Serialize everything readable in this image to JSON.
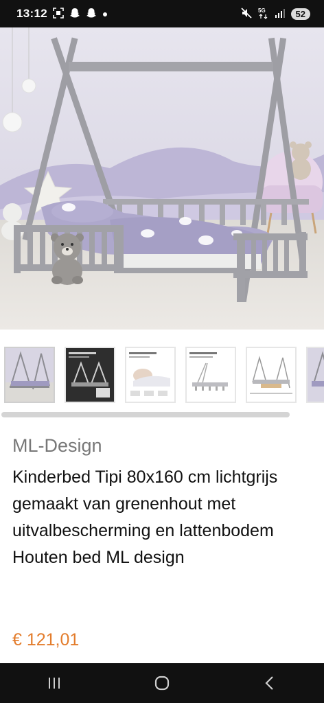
{
  "status_bar": {
    "time": "13:12",
    "battery": "52",
    "left_icons": [
      "screenshot-icon",
      "snapchat-ghost-icon",
      "snapchat-ghost-icon",
      "dot-icon"
    ],
    "right_icons": [
      "mute-icon",
      "5g-icon",
      "signal-icon",
      "battery-icon"
    ]
  },
  "product": {
    "brand": "ML-Design",
    "title": "Kinderbed Tipi 80x160 cm lichtgrijs gemaakt van grenenhout met uitvalbescherming en lattenbodem Houten bed ML design",
    "price": "€ 121,01"
  },
  "gallery": {
    "thumbnail_count_visible": 6,
    "selected_index": 0
  },
  "colors": {
    "price": "#e37c2b",
    "brand": "#777777",
    "bars": "#111111"
  },
  "navbar": {
    "icons": [
      "recent-apps-icon",
      "home-icon",
      "back-icon"
    ]
  }
}
